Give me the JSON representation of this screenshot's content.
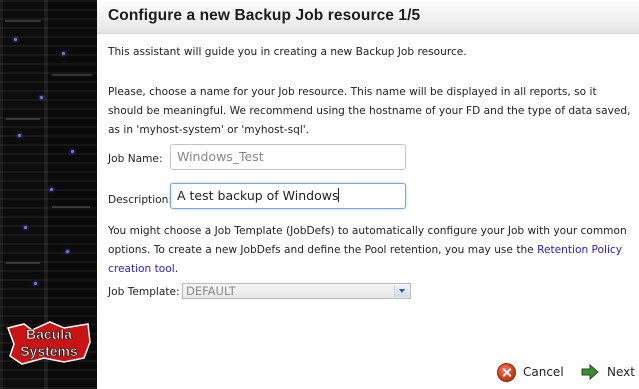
{
  "header": {
    "title": "Configure a new Backup Job resource 1/5"
  },
  "intro": "This assistant will guide you in creating a new Backup Job resource.",
  "name_help": "Please, choose a name for your Job resource. This name will be displayed in all reports, so it should be meaningful. We recommend using the hostname of your FD and the type of data saved, as in 'myhost-system' or 'myhost-sql'.",
  "form": {
    "job_name_label": "Job Name:",
    "job_name_value": "Windows_Test",
    "description_label": "Description:",
    "description_value": "A test backup of Windows"
  },
  "template_help": {
    "text": "You might choose a Job Template (JobDefs) to automatically configure your Job with your common options. To create a new JobDefs and define the Pool retention, you may use the ",
    "link": "Retention Policy creation tool",
    "end": "."
  },
  "job_template": {
    "label": "Job Template:",
    "selected": "DEFAULT"
  },
  "buttons": {
    "cancel": "Cancel",
    "next": "Next"
  },
  "logo": {
    "line1": "Bacula",
    "line2": "Systems"
  },
  "colors": {
    "link": "#2a1fb5",
    "focus_border": "#7fa7d8",
    "cancel_icon": "#d0401c",
    "next_icon": "#2f7a2a"
  }
}
